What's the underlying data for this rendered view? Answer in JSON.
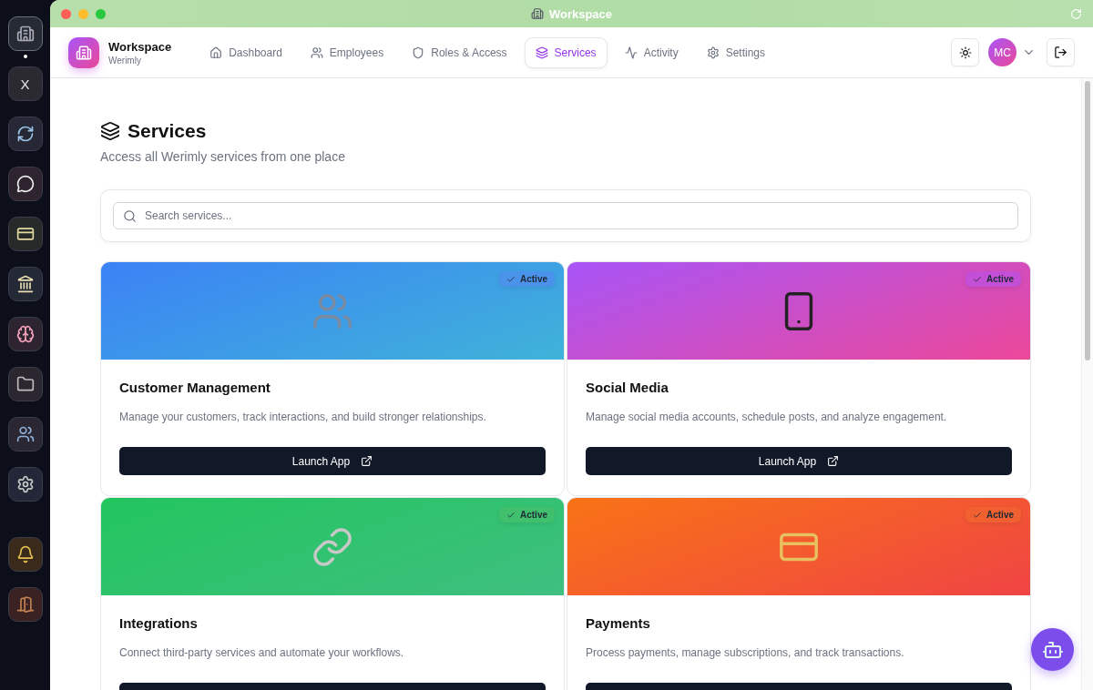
{
  "dock": [
    {
      "kind": "icon",
      "selected": true
    },
    {
      "kind": "text",
      "label": "X",
      "selected": false
    },
    {
      "kind": "icon",
      "selected": false
    },
    {
      "kind": "icon",
      "selected": false
    },
    {
      "kind": "icon",
      "selected": false
    },
    {
      "kind": "icon",
      "selected": false
    },
    {
      "kind": "icon",
      "selected": false
    },
    {
      "kind": "icon",
      "selected": false
    },
    {
      "kind": "icon",
      "selected": false
    },
    {
      "kind": "icon",
      "selected": false
    },
    {
      "kind": "icon",
      "selected": false
    },
    {
      "kind": "icon",
      "selected": false
    }
  ],
  "window": {
    "title": "Workspace"
  },
  "brand": {
    "name": "Workspace",
    "subtitle": "Werimly"
  },
  "tabs": [
    {
      "label": "Dashboard",
      "selected": false
    },
    {
      "label": "Employees",
      "selected": false
    },
    {
      "label": "Roles & Access",
      "selected": false
    },
    {
      "label": "Services",
      "selected": true
    },
    {
      "label": "Activity",
      "selected": false
    },
    {
      "label": "Settings",
      "selected": false
    }
  ],
  "user": {
    "initials": "MC"
  },
  "page": {
    "title": "Services",
    "subtitle": "Access all Werimly services from one place"
  },
  "search": {
    "placeholder": "Search services..."
  },
  "services": [
    {
      "name": "Customer Management",
      "description": "Manage your customers, track interactions, and build stronger relationships.",
      "status": "Active",
      "button": "Launch App"
    },
    {
      "name": "Social Media",
      "description": "Manage social media accounts, schedule posts, and analyze engagement.",
      "status": "Active",
      "button": "Launch App"
    },
    {
      "name": "Integrations",
      "description": "Connect third-party services and automate your workflows.",
      "status": "Active"
    },
    {
      "name": "Payments",
      "description": "Process payments, manage subscriptions, and track transactions.",
      "status": "Active"
    }
  ]
}
